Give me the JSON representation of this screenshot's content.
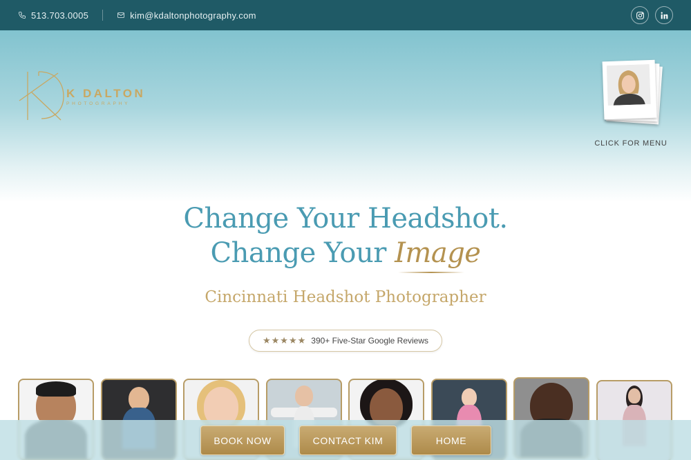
{
  "topbar": {
    "phone": "513.703.0005",
    "email": "kim@kdaltonphotography.com",
    "social": [
      "instagram-icon",
      "linkedin-icon"
    ]
  },
  "logo": {
    "brand": "K DALTON",
    "sub": "PHOTOGRAPHY"
  },
  "menu": {
    "label": "CLICK FOR MENU"
  },
  "hero": {
    "line1": "Change Your Headshot.",
    "line2_prefix": "Change Your ",
    "line2_accent": "Image",
    "subtitle": "Cincinnati Headshot Photographer"
  },
  "reviews": {
    "stars": 5,
    "text": "390+ Five-Star Google Reviews"
  },
  "actions": {
    "book": "BOOK NOW",
    "contact": "CONTACT KIM",
    "home": "HOME"
  },
  "colors": {
    "topbar": "#1f5a66",
    "headline": "#4a9bb2",
    "gold": "#b49250",
    "button": "#b8975a"
  }
}
